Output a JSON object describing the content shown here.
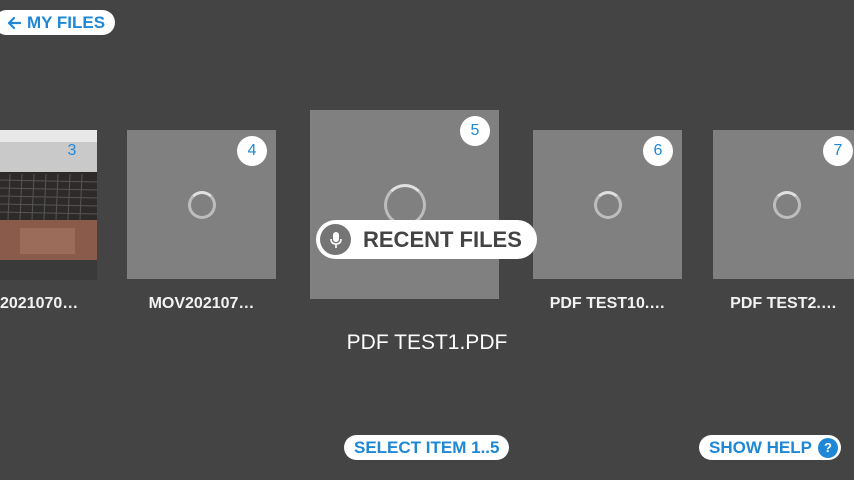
{
  "header": {
    "back_label": "MY FILES",
    "back_icon": "arrow-left-icon"
  },
  "files": [
    {
      "number": "3",
      "name": "2021070…"
    },
    {
      "number": "4",
      "name": "MOV202107…"
    },
    {
      "number": "5",
      "name": "PDF TEST1.PDF"
    },
    {
      "number": "6",
      "name": "PDF TEST10.…"
    },
    {
      "number": "7",
      "name": "PDF TEST2.…"
    }
  ],
  "voice_tooltip": {
    "label": "RECENT FILES",
    "icon": "mic-icon"
  },
  "footer": {
    "select_label": "SELECT ITEM 1..5",
    "help_label": "SHOW HELP",
    "help_icon_glyph": "?"
  },
  "colors": {
    "background": "#444444",
    "accent": "#1e88d6",
    "tile": "#808080"
  }
}
